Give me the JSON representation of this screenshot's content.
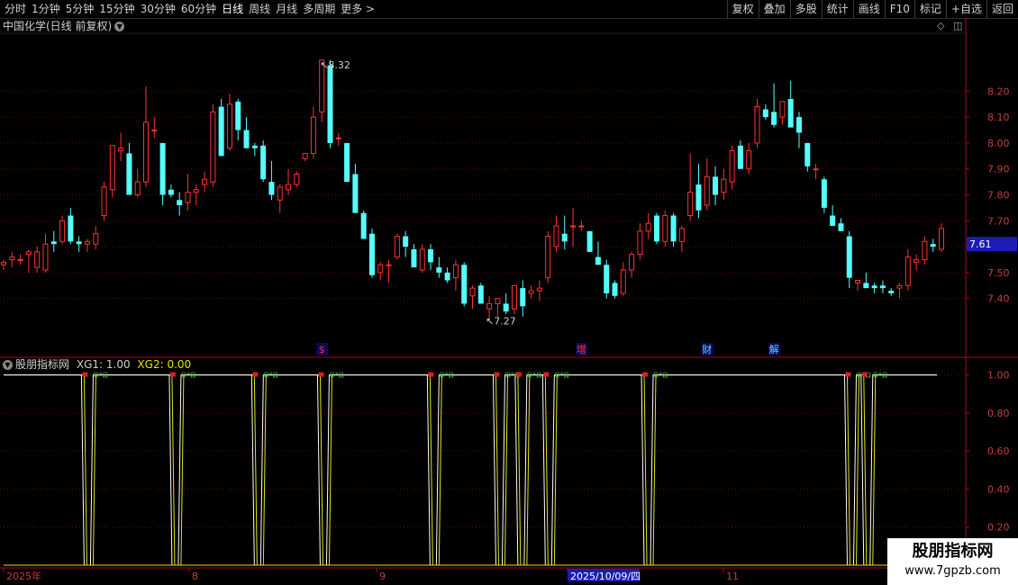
{
  "toolbar": {
    "periods": [
      "分时",
      "1分钟",
      "5分钟",
      "15分钟",
      "30分钟",
      "60分钟",
      "日线",
      "周线",
      "月线",
      "多周期",
      "更多 >"
    ],
    "active_period": "日线",
    "right_buttons": [
      "复权",
      "叠加",
      "多股",
      "统计",
      "画线",
      "F10",
      "标记",
      "+自选",
      "返回"
    ]
  },
  "main": {
    "title": "中国化学(日线 前复权)",
    "current_price": "7.61",
    "high_label": "8.32",
    "low_label": "7.27",
    "markers": [
      {
        "text": "$",
        "color": "#ff3030",
        "x_index": 38
      },
      {
        "text": "增",
        "color": "#ff3030",
        "x_index": 69
      },
      {
        "text": "财",
        "color": "#66ccff",
        "x_index": 84
      },
      {
        "text": "解",
        "color": "#66ccff",
        "x_index": 92
      }
    ]
  },
  "indicator": {
    "name": "股朋指标网",
    "xg1_label": "XG1:",
    "xg1_value": "1.00",
    "xg2_label": "XG2:",
    "xg2_value": "0.00"
  },
  "date_axis": [
    "2025年",
    "8",
    "9",
    "2025/10/09/四",
    "11"
  ],
  "watermark": {
    "line1": "股朋指标网",
    "line2": "www.7gpzb.com"
  },
  "chart_data": {
    "type": "candlestick",
    "y_axis_ticks": [
      "8.20",
      "8.10",
      "8.00",
      "7.90",
      "7.80",
      "7.70",
      "7.60",
      "7.50",
      "7.40"
    ],
    "ylim": [
      7.18,
      8.42
    ],
    "candles": [
      [
        7.53,
        7.55,
        7.51,
        7.54
      ],
      [
        7.55,
        7.58,
        7.52,
        7.56
      ],
      [
        7.55,
        7.57,
        7.53,
        7.55
      ],
      [
        7.57,
        7.59,
        7.5,
        7.58
      ],
      [
        7.52,
        7.6,
        7.5,
        7.58
      ],
      [
        7.51,
        7.65,
        7.5,
        7.61
      ],
      [
        7.62,
        7.66,
        7.58,
        7.61
      ],
      [
        7.62,
        7.72,
        7.61,
        7.7
      ],
      [
        7.72,
        7.75,
        7.61,
        7.62
      ],
      [
        7.62,
        7.64,
        7.58,
        7.61
      ],
      [
        7.61,
        7.63,
        7.58,
        7.62
      ],
      [
        7.61,
        7.68,
        7.59,
        7.65
      ],
      [
        7.72,
        7.85,
        7.7,
        7.83
      ],
      [
        7.82,
        7.97,
        7.79,
        7.99
      ],
      [
        7.97,
        8.04,
        7.93,
        7.98
      ],
      [
        7.96,
        8.0,
        7.8,
        7.8
      ],
      [
        7.8,
        7.9,
        7.79,
        7.85
      ],
      [
        7.85,
        8.22,
        7.83,
        8.08
      ],
      [
        8.05,
        8.1,
        8.02,
        8.05
      ],
      [
        8.0,
        8.0,
        7.76,
        7.8
      ],
      [
        7.82,
        7.84,
        7.79,
        7.8
      ],
      [
        7.78,
        7.81,
        7.72,
        7.76
      ],
      [
        7.77,
        7.88,
        7.74,
        7.81
      ],
      [
        7.81,
        7.84,
        7.76,
        7.82
      ],
      [
        7.84,
        7.89,
        7.81,
        7.86
      ],
      [
        7.85,
        8.15,
        7.83,
        8.12
      ],
      [
        8.14,
        8.17,
        7.95,
        7.95
      ],
      [
        7.98,
        8.19,
        7.97,
        8.15
      ],
      [
        8.16,
        8.17,
        8.01,
        8.05
      ],
      [
        8.05,
        8.1,
        7.98,
        7.98
      ],
      [
        7.99,
        8.0,
        7.95,
        7.98
      ],
      [
        7.99,
        8.01,
        7.85,
        7.86
      ],
      [
        7.85,
        7.93,
        7.78,
        7.8
      ],
      [
        7.78,
        7.84,
        7.73,
        7.83
      ],
      [
        7.82,
        7.9,
        7.8,
        7.84
      ],
      [
        7.84,
        7.89,
        7.83,
        7.88
      ],
      [
        7.94,
        7.96,
        7.93,
        7.96
      ],
      [
        7.96,
        8.14,
        7.94,
        8.1
      ],
      [
        8.12,
        8.32,
        8.08,
        8.32
      ],
      [
        8.3,
        8.32,
        7.98,
        8.0
      ],
      [
        8.02,
        8.04,
        7.99,
        8.02
      ],
      [
        8.0,
        8.0,
        7.86,
        7.85
      ],
      [
        7.88,
        7.92,
        7.73,
        7.73
      ],
      [
        7.73,
        7.74,
        7.63,
        7.63
      ],
      [
        7.65,
        7.67,
        7.48,
        7.49
      ],
      [
        7.5,
        7.54,
        7.47,
        7.53
      ],
      [
        7.53,
        7.55,
        7.46,
        7.53
      ],
      [
        7.56,
        7.65,
        7.55,
        7.64
      ],
      [
        7.64,
        7.66,
        7.56,
        7.6
      ],
      [
        7.59,
        7.61,
        7.52,
        7.52
      ],
      [
        7.51,
        7.61,
        7.5,
        7.59
      ],
      [
        7.59,
        7.61,
        7.51,
        7.54
      ],
      [
        7.52,
        7.56,
        7.48,
        7.5
      ],
      [
        7.5,
        7.52,
        7.46,
        7.47
      ],
      [
        7.48,
        7.55,
        7.43,
        7.53
      ],
      [
        7.53,
        7.54,
        7.37,
        7.38
      ],
      [
        7.41,
        7.45,
        7.36,
        7.44
      ],
      [
        7.45,
        7.46,
        7.4,
        7.38
      ],
      [
        7.36,
        7.41,
        7.32,
        7.38
      ],
      [
        7.38,
        7.4,
        7.33,
        7.4
      ],
      [
        7.38,
        7.42,
        7.34,
        7.35
      ],
      [
        7.36,
        7.45,
        7.34,
        7.45
      ],
      [
        7.44,
        7.47,
        7.33,
        7.37
      ],
      [
        7.42,
        7.45,
        7.4,
        7.43
      ],
      [
        7.43,
        7.47,
        7.39,
        7.44
      ],
      [
        7.48,
        7.66,
        7.46,
        7.64
      ],
      [
        7.6,
        7.72,
        7.58,
        7.68
      ],
      [
        7.65,
        7.72,
        7.59,
        7.62
      ],
      [
        7.68,
        7.75,
        7.6,
        7.68
      ],
      [
        7.68,
        7.7,
        7.66,
        7.68
      ],
      [
        7.66,
        7.66,
        7.58,
        7.58
      ],
      [
        7.56,
        7.62,
        7.55,
        7.53
      ],
      [
        7.53,
        7.55,
        7.4,
        7.42
      ],
      [
        7.46,
        7.47,
        7.4,
        7.41
      ],
      [
        7.42,
        7.54,
        7.41,
        7.51
      ],
      [
        7.51,
        7.58,
        7.48,
        7.57
      ],
      [
        7.57,
        7.69,
        7.55,
        7.66
      ],
      [
        7.66,
        7.73,
        7.63,
        7.69
      ],
      [
        7.72,
        7.73,
        7.61,
        7.62
      ],
      [
        7.62,
        7.74,
        7.6,
        7.72
      ],
      [
        7.72,
        7.73,
        7.6,
        7.62
      ],
      [
        7.62,
        7.68,
        7.58,
        7.67
      ],
      [
        7.72,
        7.96,
        7.7,
        7.81
      ],
      [
        7.84,
        7.92,
        7.71,
        7.74
      ],
      [
        7.76,
        7.94,
        7.74,
        7.87
      ],
      [
        7.87,
        7.91,
        7.76,
        7.8
      ],
      [
        7.81,
        7.9,
        7.78,
        7.86
      ],
      [
        7.85,
        7.99,
        7.82,
        7.97
      ],
      [
        7.99,
        8.01,
        7.9,
        7.9
      ],
      [
        7.9,
        8.0,
        7.88,
        7.97
      ],
      [
        8.0,
        8.17,
        7.98,
        8.14
      ],
      [
        8.13,
        8.15,
        8.09,
        8.1
      ],
      [
        8.12,
        8.23,
        8.06,
        8.07
      ],
      [
        8.1,
        8.15,
        8.07,
        8.16
      ],
      [
        8.17,
        8.24,
        8.07,
        8.06
      ],
      [
        8.1,
        8.12,
        7.98,
        8.04
      ],
      [
        8.0,
        8.0,
        7.89,
        7.91
      ],
      [
        7.9,
        7.92,
        7.86,
        7.9
      ],
      [
        7.86,
        7.87,
        7.73,
        7.75
      ],
      [
        7.72,
        7.76,
        7.69,
        7.68
      ],
      [
        7.69,
        7.71,
        7.66,
        7.66
      ],
      [
        7.64,
        7.66,
        7.44,
        7.48
      ],
      [
        7.46,
        7.47,
        7.43,
        7.47
      ],
      [
        7.46,
        7.5,
        7.44,
        7.44
      ],
      [
        7.45,
        7.46,
        7.42,
        7.44
      ],
      [
        7.45,
        7.47,
        7.42,
        7.44
      ],
      [
        7.43,
        7.44,
        7.41,
        7.42
      ],
      [
        7.44,
        7.46,
        7.4,
        7.45
      ],
      [
        7.45,
        7.59,
        7.43,
        7.56
      ],
      [
        7.54,
        7.57,
        7.51,
        7.55
      ],
      [
        7.55,
        7.64,
        7.53,
        7.62
      ],
      [
        7.61,
        7.63,
        7.58,
        7.6
      ],
      [
        7.59,
        7.69,
        7.58,
        7.67
      ]
    ],
    "indicator_y_ticks": [
      "1.00",
      "0.80",
      "0.60",
      "0.40",
      "0.20"
    ],
    "indicator_ylim": [
      0,
      1.05
    ],
    "signal_dips": [
      15,
      31,
      46,
      58,
      78,
      90,
      94,
      99,
      117,
      154,
      157
    ],
    "series": [
      {
        "name": "XG1",
        "color": "#ffffff"
      },
      {
        "name": "XG2",
        "color": "#e6e600"
      }
    ]
  }
}
